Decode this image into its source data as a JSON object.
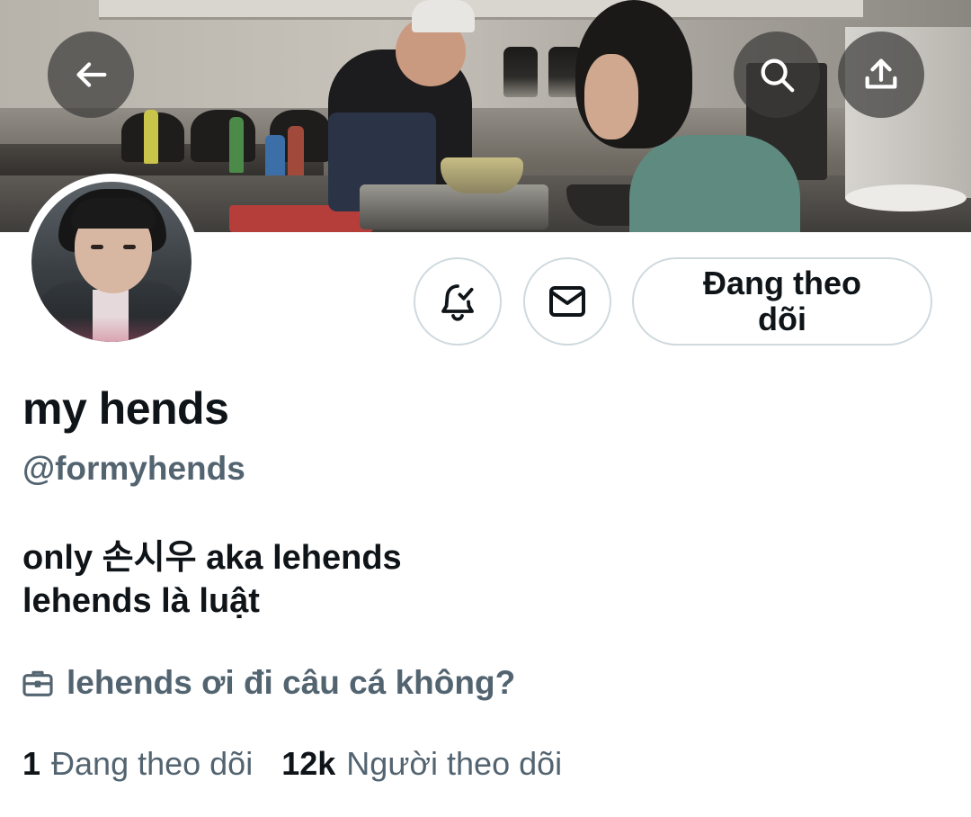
{
  "header": {
    "back_icon": "arrow-left-icon",
    "search_icon": "search-icon",
    "share_icon": "share-upload-icon"
  },
  "actions": {
    "notify_icon": "bell-check-icon",
    "message_icon": "envelope-icon",
    "follow_label": "Đang theo dõi"
  },
  "profile": {
    "display_name": "my hends",
    "handle": "@formyhends",
    "bio_line1": "only 손시우 aka lehends",
    "bio_line2": "lehends là luật",
    "category_icon": "briefcase-icon",
    "category": "lehends ơi đi câu cá không?"
  },
  "stats": {
    "following_count": "1",
    "following_label": "Đang theo dõi",
    "followers_count": "12k",
    "followers_label": "Người theo dõi"
  },
  "colors": {
    "text_primary": "#0f1419",
    "text_secondary": "#536471",
    "border": "#cfd9de",
    "overlay_button": "#3c3c3a"
  }
}
